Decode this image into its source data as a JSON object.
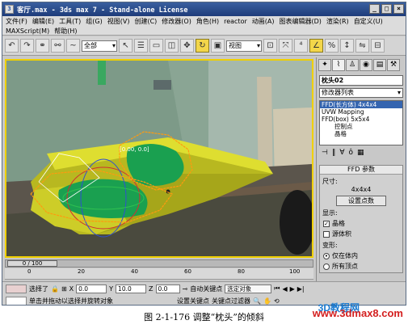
{
  "window": {
    "title": "客厅.max - 3ds max 7  - Stand-alone License",
    "controls": [
      "_",
      "□",
      "×"
    ]
  },
  "menu": {
    "row1": [
      "文件(F)",
      "编辑(E)",
      "工具(T)",
      "组(G)",
      "视图(V)",
      "创建(C)",
      "修改器(O)",
      "角色(H)",
      "reactor",
      "动画(A)",
      "图表编辑器(D)",
      "渲染(R)",
      "自定义(U)"
    ],
    "row2": [
      "MAXScript(M)",
      "帮助(H)"
    ]
  },
  "toolbar": {
    "selection_filter": "全部",
    "coord_system": "视图"
  },
  "viewport": {
    "label": "透视"
  },
  "command_panel": {
    "object_name": "枕头02",
    "modifier_list": "修改器列表",
    "stack": [
      "FFD(长方体) 4x4x4",
      "UVW Mapping",
      "FFD(box) 5x5x4",
      "控制点",
      "晶格"
    ],
    "rollout_title": "FFD 参数",
    "size_label": "尺寸:",
    "size_value": "4x4x4",
    "set_points_button": "设置点数",
    "display_label": "显示:",
    "lattice_checkbox": "晶格",
    "source_volume_checkbox": "源体积",
    "deform_label": "变形:",
    "only_in_volume": "仅在体内",
    "all_vertices": "所有顶点"
  },
  "timeline": {
    "frame_indicator": "0 / 100",
    "ticks": [
      "0",
      "20",
      "40",
      "60",
      "80",
      "100"
    ]
  },
  "status": {
    "selection": "选择了",
    "x_label": "X",
    "x_value": "0.0",
    "y_label": "Y",
    "y_value": "10.0",
    "z_label": "Z",
    "z_value": "0.0",
    "auto_key": "自动关键点",
    "selected_object": "选定对象",
    "set_key": "设置关键点",
    "key_filter": "关键点过滤器",
    "prompt": "单击并拖动以选择并旋转对象"
  },
  "caption": "图 2-1-176   调整“枕头”的倾斜",
  "watermark_logo": "3D教程网",
  "watermark": "www.3dmax8.com"
}
